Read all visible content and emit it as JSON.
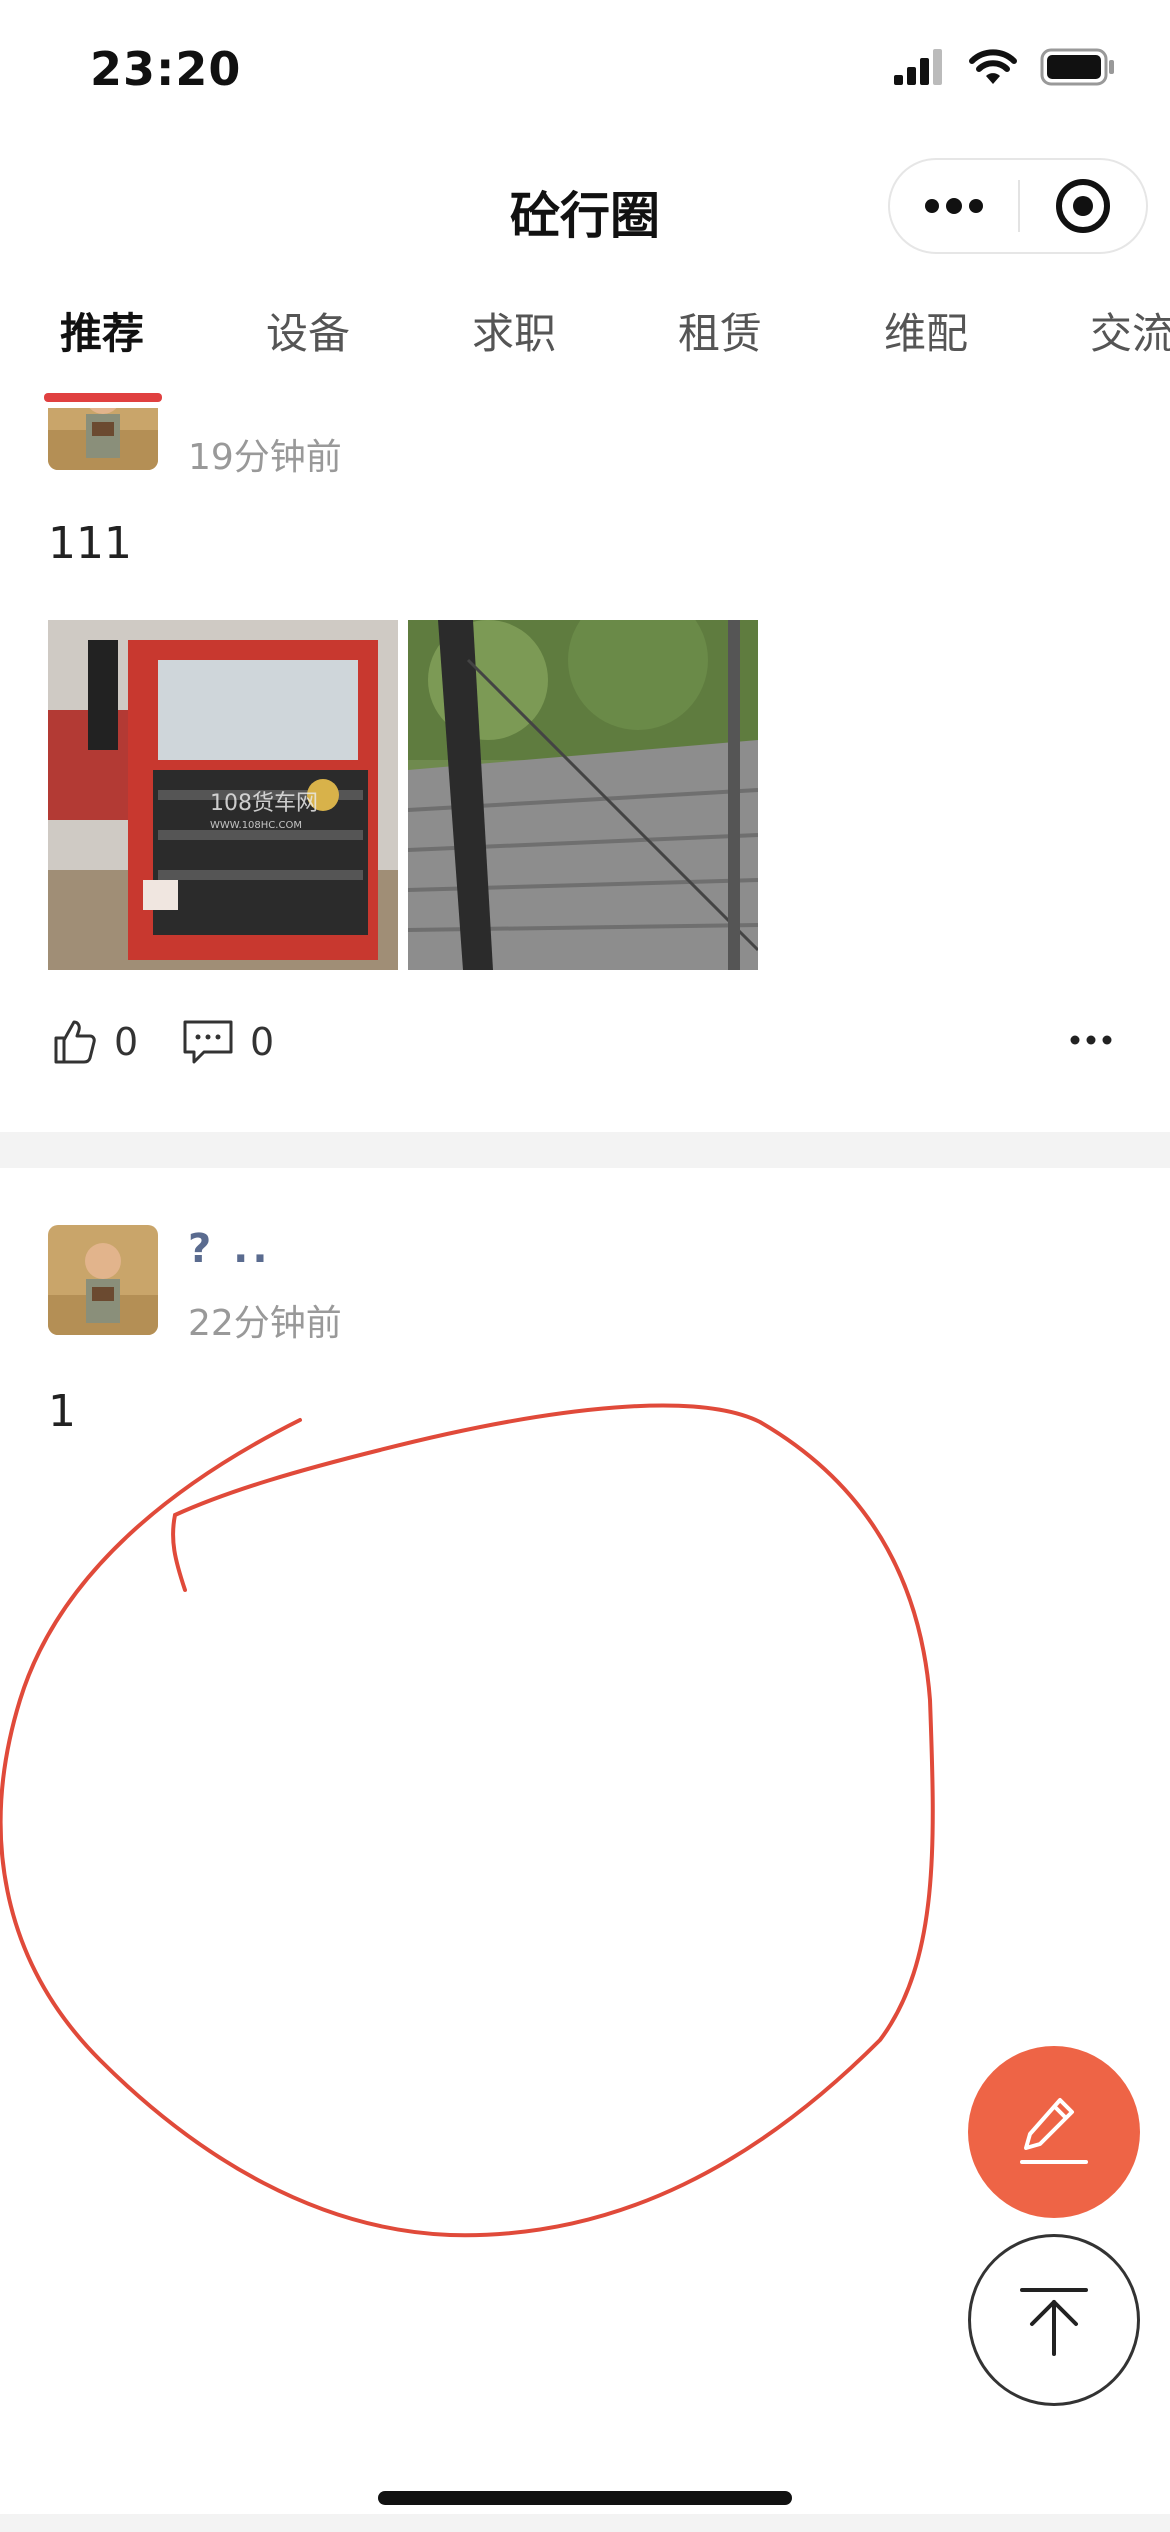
{
  "status_bar": {
    "time": "23:20"
  },
  "nav": {
    "title": "砼行圈"
  },
  "tabs": [
    {
      "label": "推荐",
      "active": true
    },
    {
      "label": "设备",
      "active": false
    },
    {
      "label": "求职",
      "active": false
    },
    {
      "label": "租赁",
      "active": false
    },
    {
      "label": "维配",
      "active": false
    },
    {
      "label": "交流",
      "active": false
    }
  ],
  "posts": [
    {
      "time": "19分钟前",
      "text": "111",
      "images": [
        {
          "watermark": "108货车网",
          "watermark_url": "WWW.108HC.COM"
        },
        {}
      ],
      "likes": "0",
      "comments": "0"
    },
    {
      "author": "? ..",
      "time": "22分钟前",
      "text": "1"
    }
  ],
  "colors": {
    "accent": "#e04040",
    "fab": "#ee6446",
    "name": "#5a6b8f",
    "annotation": "#e04a3a"
  },
  "icons": [
    "signal-icon",
    "wifi-icon",
    "battery-icon",
    "more-icon",
    "target-icon",
    "like-icon",
    "comment-icon",
    "pencil-icon",
    "back-to-top-icon"
  ]
}
